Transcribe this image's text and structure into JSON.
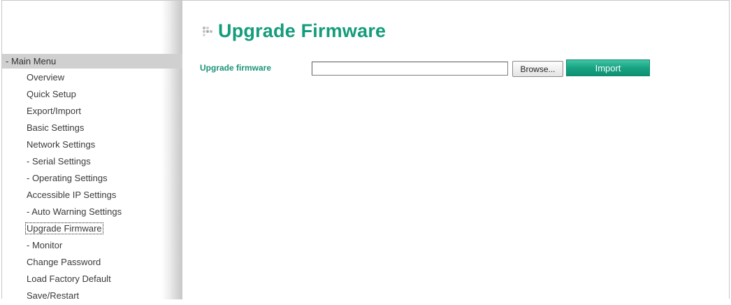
{
  "colors": {
    "accent": "#149c7c",
    "label": "#1a9477",
    "import_button": "#18a383",
    "menu_header_bg": "#d0d0d0"
  },
  "sidebar": {
    "header": "- Main Menu",
    "items": [
      {
        "label": "Overview"
      },
      {
        "label": "Quick Setup"
      },
      {
        "label": "Export/Import"
      },
      {
        "label": "Basic Settings"
      },
      {
        "label": "Network Settings"
      },
      {
        "label": "- Serial Settings"
      },
      {
        "label": "- Operating Settings"
      },
      {
        "label": "Accessible IP Settings"
      },
      {
        "label": "- Auto Warning Settings"
      },
      {
        "label": "Upgrade Firmware",
        "active": true
      },
      {
        "label": "- Monitor"
      },
      {
        "label": "Change Password"
      },
      {
        "label": "Load Factory Default"
      },
      {
        "label": "Save/Restart"
      }
    ]
  },
  "main": {
    "title": "Upgrade Firmware",
    "title_icon": "dots-bullet-icon",
    "form": {
      "label": "Upgrade firmware",
      "file_value": "",
      "browse_label": "Browse...",
      "import_label": "Import"
    }
  }
}
